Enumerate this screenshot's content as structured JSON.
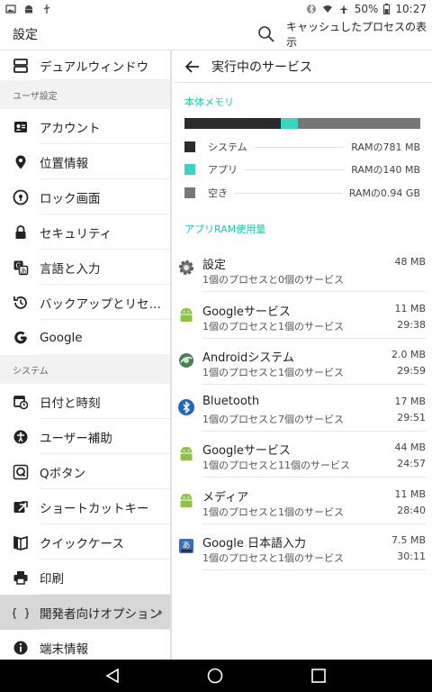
{
  "statusbar": {
    "battery": "50%",
    "time": "10:27"
  },
  "appbar": {
    "title": "設定",
    "action": "キャッシュしたプロセスの表示"
  },
  "sidebar": {
    "top_item": "デュアルウィンドウ",
    "header_user": "ユーザ設定",
    "user_items": [
      {
        "label": "アカウント",
        "icon": "account-icon"
      },
      {
        "label": "位置情報",
        "icon": "location-icon"
      },
      {
        "label": "ロック画面",
        "icon": "lock-screen-icon"
      },
      {
        "label": "セキュリティ",
        "icon": "security-lock-icon"
      },
      {
        "label": "言語と入力",
        "icon": "language-icon"
      },
      {
        "label": "バックアップとリセ…",
        "icon": "backup-icon"
      },
      {
        "label": "Google",
        "icon": "google-icon"
      }
    ],
    "header_system": "システム",
    "system_items": [
      {
        "label": "日付と時刻",
        "icon": "clock-icon"
      },
      {
        "label": "ユーザー補助",
        "icon": "accessibility-icon"
      },
      {
        "label": "Qボタン",
        "icon": "q-button-icon"
      },
      {
        "label": "ショートカットキー",
        "icon": "shortcut-icon"
      },
      {
        "label": "クイックケース",
        "icon": "quick-case-icon"
      },
      {
        "label": "印刷",
        "icon": "print-icon"
      },
      {
        "label": "開発者向けオプション",
        "icon": "developer-braces-icon",
        "chevron": "›"
      },
      {
        "label": "端末情報",
        "icon": "info-icon"
      }
    ]
  },
  "main": {
    "title": "実行中のサービス",
    "memory_label": "本体メモリ",
    "memory_bar": {
      "system_fraction": 0.41,
      "app_fraction": 0.07,
      "free_fraction": 0.52
    },
    "legend": [
      {
        "label": "システム",
        "value": "RAMの781 MB",
        "color": "#2b2b2b"
      },
      {
        "label": "アプリ",
        "value": "RAMの140 MB",
        "color": "#3ed3c0"
      },
      {
        "label": "空き",
        "value": "RAMの0.94 GB",
        "color": "#777777"
      }
    ],
    "app_ram_label": "アプリRAM使用量",
    "apps": [
      {
        "name": "設定",
        "sub": "1個のプロセスと0個のサービス",
        "size": "48 MB",
        "time": "",
        "icon": "settings-gear-icon"
      },
      {
        "name": "Googleサービス",
        "sub": "1個のプロセスと1個のサービス",
        "size": "11 MB",
        "time": "29:38",
        "icon": "android-icon"
      },
      {
        "name": "Androidシステム",
        "sub": "1個のプロセスと1個のサービス",
        "size": "2.0 MB",
        "time": "29:59",
        "icon": "android-system-icon"
      },
      {
        "name": "Bluetooth",
        "sub": "1個のプロセスと7個のサービス",
        "size": "17 MB",
        "time": "29:51",
        "icon": "bluetooth-icon"
      },
      {
        "name": "Googleサービス",
        "sub": "1個のプロセスと11個のサービス",
        "size": "44 MB",
        "time": "24:57",
        "icon": "android-icon"
      },
      {
        "name": "メディア",
        "sub": "1個のプロセスと1個のサービス",
        "size": "11 MB",
        "time": "28:40",
        "icon": "android-icon"
      },
      {
        "name": "Google 日本語入力",
        "sub": "1個のプロセスと1個のサービス",
        "size": "7.5 MB",
        "time": "30:11",
        "icon": "japanese-input-icon"
      }
    ]
  },
  "colors": {
    "accent": "#25c6a8",
    "app_segment": "#3ed3c0",
    "system_segment": "#2b2b2b",
    "free_segment": "#777777"
  }
}
